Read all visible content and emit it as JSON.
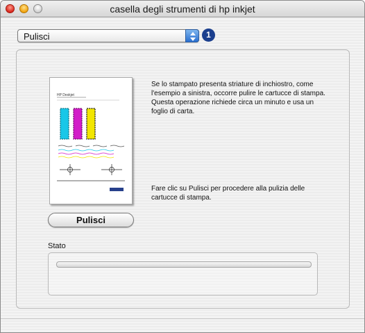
{
  "window": {
    "title": "casella degli strumenti di hp inkjet"
  },
  "panel_select": {
    "selected": "Pulisci",
    "step_badge": "1"
  },
  "preview": {
    "page_heading": "HP Deskjet",
    "icon": "test-page-thumbnail"
  },
  "texts": {
    "description": "Se lo stampato presenta striature di inchiostro, come l'esempio a sinistra, occorre pulire le cartucce di stampa. Questa operazione richiede circa un minuto e usa un foglio di carta.",
    "instruction": "Fare clic su Pulisci per procedere alla pulizia delle cartucce di stampa."
  },
  "actions": {
    "clean_button": "Pulisci"
  },
  "status": {
    "label": "Stato",
    "progress": 0
  },
  "colors": {
    "select_arrow": "#2a6fd0",
    "badge": "#1b3f8e",
    "cyan": "#19c7e8",
    "magenta": "#d21ec8",
    "yellow": "#f2e600"
  }
}
